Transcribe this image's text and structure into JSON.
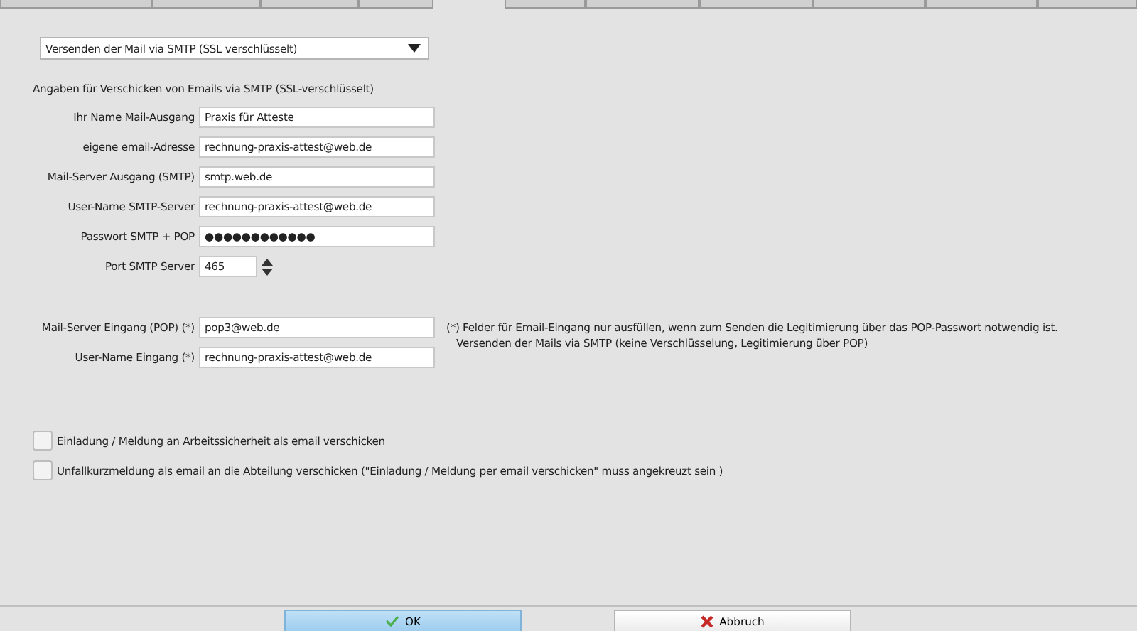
{
  "mode_select": {
    "value": "Versenden der Mail via SMTP (SSL verschlüsselt)"
  },
  "section_title": "Angaben für Verschicken von Emails via SMTP (SSL-verschlüsselt)",
  "smtp_fields": [
    {
      "label": "Ihr Name Mail-Ausgang",
      "value": "Praxis für Atteste",
      "kind": "text"
    },
    {
      "label": "eigene email-Adresse",
      "value": "rechnung-praxis-attest@web.de",
      "kind": "text"
    },
    {
      "label": "Mail-Server Ausgang (SMTP)",
      "value": "smtp.web.de",
      "kind": "text"
    },
    {
      "label": "User-Name SMTP-Server",
      "value": "rechnung-praxis-attest@web.de",
      "kind": "text"
    },
    {
      "label": "Passwort SMTP + POP",
      "value": "●●●●●●●●●●●●",
      "kind": "text"
    },
    {
      "label": "Port SMTP Server",
      "value": "465",
      "kind": "spin"
    }
  ],
  "pop_fields": [
    {
      "label": "Mail-Server Eingang (POP) (*)",
      "value": "pop3@web.de"
    },
    {
      "label": "User-Name Eingang (*)",
      "value": "rechnung-praxis-attest@web.de"
    }
  ],
  "pop_note": [
    "(*) Felder für Email-Eingang nur ausfüllen, wenn zum Senden die Legitimierung über das POP-Passwort notwendig ist.",
    "Versenden der Mails via SMTP (keine Verschlüsselung, Legitimierung über POP)"
  ],
  "checkboxes": [
    {
      "label": "Einladung / Meldung an Arbeitssicherheit als email verschicken",
      "checked": false
    },
    {
      "label": "Unfallkurzmeldung als email an die Abteilung verschicken (\"Einladung / Meldung per email verschicken\" muss angekreuzt sein )",
      "checked": false
    }
  ],
  "buttons": [
    {
      "label": "OK",
      "kind": "ok"
    },
    {
      "label": "Abbruch",
      "kind": "cancel"
    }
  ]
}
